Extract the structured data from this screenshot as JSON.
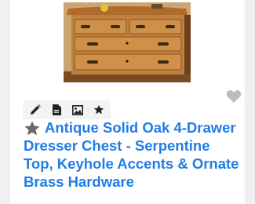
{
  "listing": {
    "title": "Antique Solid Oak 4-Drawer Dresser Chest - Serpentine Top, Keyhole Accents & Ornate Brass Hardware",
    "photo_alt": "Antique oak dresser photo"
  },
  "toolbar": {
    "tools": [
      {
        "icon": "pencil-icon",
        "label": "edit"
      },
      {
        "icon": "document-icon",
        "label": "details"
      },
      {
        "icon": "image-icon",
        "label": "photos"
      },
      {
        "icon": "star-icon",
        "label": "feature"
      }
    ]
  },
  "favorite": {
    "icon": "heart-icon"
  },
  "colors": {
    "title": "#1f7de8",
    "icon_dark": "#222222",
    "star_gray": "#6b6b6b",
    "heart_gray": "#bdbdbd",
    "toolbar_bg": "#f3f3f3"
  }
}
